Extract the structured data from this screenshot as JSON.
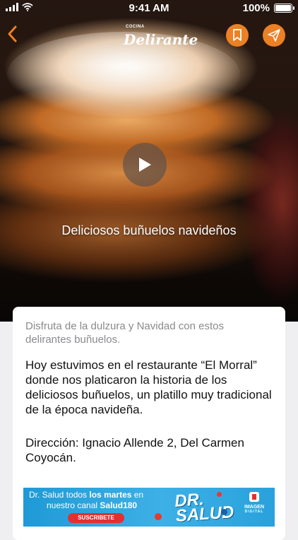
{
  "status_bar": {
    "time": "9:41 AM",
    "battery": "100%"
  },
  "header": {
    "logo_small": "COCINA",
    "logo_big": "Delirante",
    "icons": [
      "back-chevron-icon",
      "bookmark-icon",
      "send-icon"
    ]
  },
  "hero": {
    "title": "Deliciosos buñuelos navideños",
    "play_icon": "play-icon"
  },
  "article": {
    "subtitle": "Disfruta de la dulzura y Navidad con estos delirantes buñuelos.",
    "body": "Hoy estuvimos en el restaurante “El Morral” donde nos platicaron la historia de los deliciosos buñuelos, un platillo muy tradicional de la época navideña.",
    "address": "Dirección: Ignacio Allende 2, Del Carmen Coyocán."
  },
  "banner": {
    "line1_prefix": "Dr. Salud todos ",
    "line1_bold": "los martes",
    "line1_suffix": " en",
    "line2_prefix": "nuestro canal ",
    "line2_bold": "Salud180",
    "cta": "SUSCRIBETE",
    "brand_line1": "DR.",
    "brand_line2": "SALUD",
    "network": "IMAGEN",
    "network_sub": "DIGITAL"
  },
  "colors": {
    "accent": "#ec8024",
    "banner_blue": "#2aa1dc",
    "banner_red": "#e0312f"
  }
}
